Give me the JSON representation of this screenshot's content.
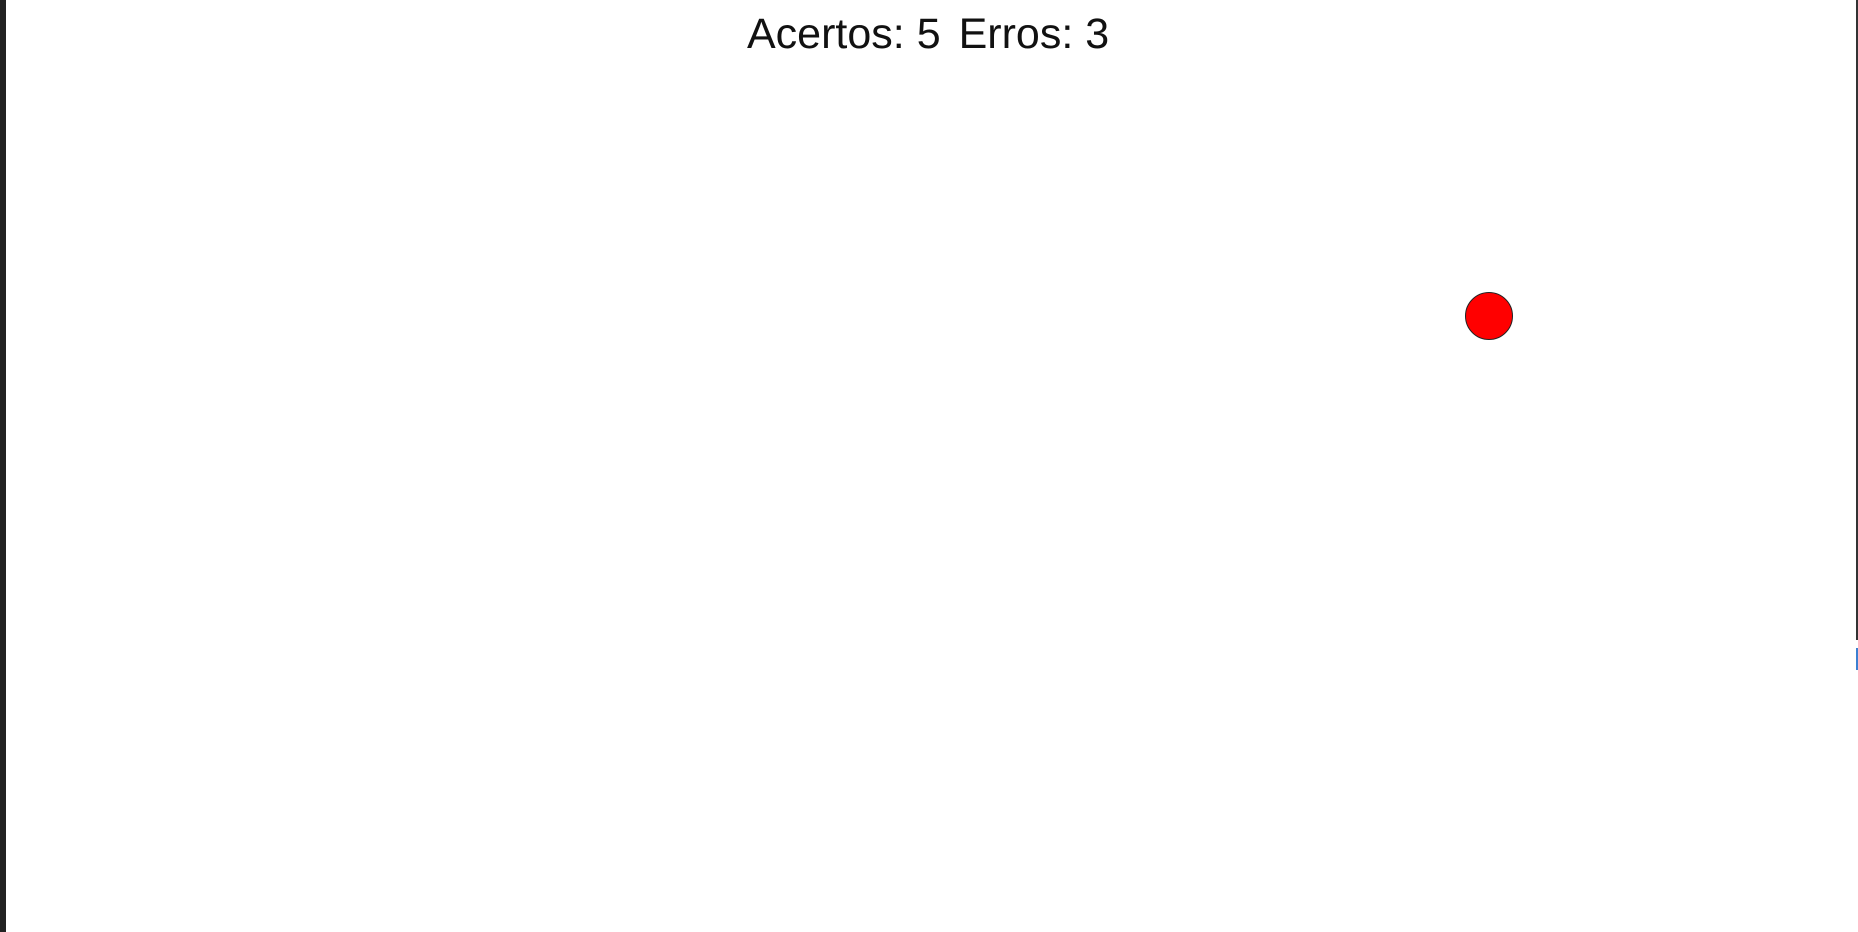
{
  "score": {
    "hits_label": "Acertos:",
    "hits_value": "5",
    "misses_label": "Erros:",
    "misses_value": "3"
  },
  "target": {
    "color": "#ff0000"
  }
}
